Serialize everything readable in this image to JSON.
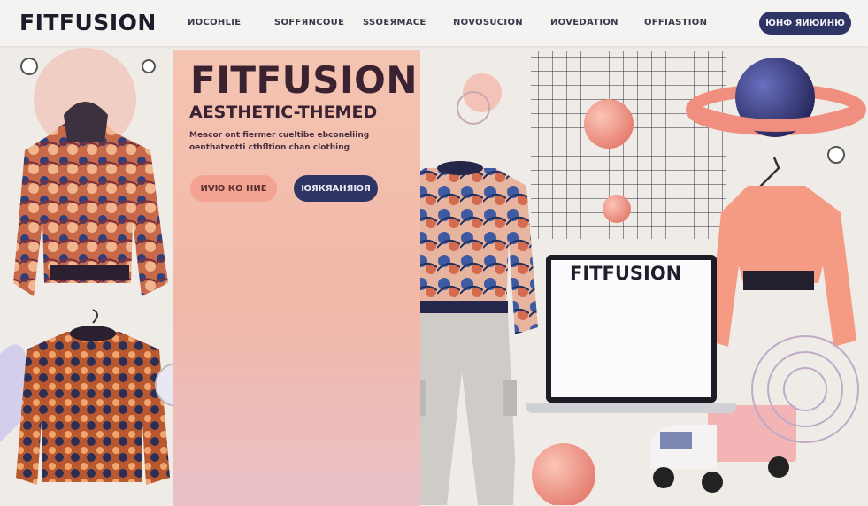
{
  "navbar": {
    "logo": "FITFUSION",
    "items": [
      "ИOCOHLIE",
      "SOFFЯNCOUE",
      "SSOEЯMACE",
      "NOVOSUCION",
      "ИOVEDATION",
      "OFFIASTION"
    ],
    "cta": "ЮНФ ЯИЮИНЮ"
  },
  "hero": {
    "title": "FITFUSION",
    "subtitle": "AESTHETIC-THEMED",
    "description": "Meacor ont fiermer cueltibe ebconeliing oenthatvotti cthfltion chan clothing",
    "primary_button": "ИVЮ КО НИЕ",
    "secondary_button": "ЮЯКЯАНЯЮЯ"
  },
  "laptop": {
    "brand": "FITFUSION"
  },
  "colors": {
    "navy": "#2e3464",
    "peach": "#f3a392",
    "coral": "#f08f80",
    "lavender": "#b9b6ea",
    "background": "#efece8"
  }
}
